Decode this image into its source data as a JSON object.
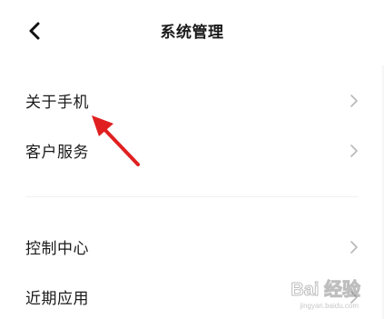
{
  "header": {
    "back_icon": "chevron-left-icon",
    "title": "系统管理"
  },
  "groups": [
    {
      "items": [
        {
          "label": "关于手机",
          "icon": "chevron-right-icon"
        },
        {
          "label": "客户服务",
          "icon": "chevron-right-icon"
        }
      ]
    },
    {
      "items": [
        {
          "label": "控制中心",
          "icon": "chevron-right-icon"
        },
        {
          "label": "近期应用",
          "icon": "chevron-right-icon"
        }
      ]
    }
  ],
  "annotation": {
    "arrow_color": "#e02020",
    "points_to": "关于手机"
  },
  "watermark": {
    "text": "Bai 经验",
    "sub": "jingyan.baidu.com"
  }
}
